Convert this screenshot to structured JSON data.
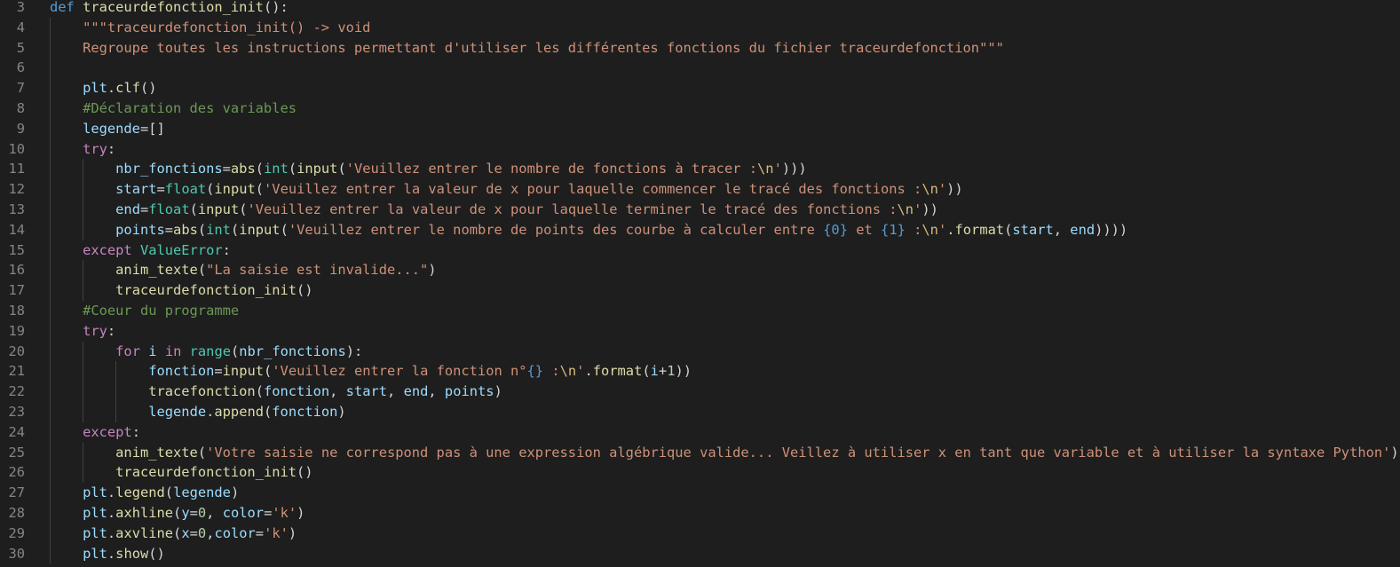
{
  "editor": {
    "lines": [
      {
        "number": "3",
        "indent": 0,
        "tokens": [
          [
            "kw",
            "def"
          ],
          [
            "txt",
            " "
          ],
          [
            "fn",
            "traceurdefonction_init"
          ],
          [
            "txt",
            "():"
          ]
        ]
      },
      {
        "number": "4",
        "indent": 1,
        "tokens": [
          [
            "str",
            "\"\"\"traceurdefonction_init() -> void"
          ]
        ]
      },
      {
        "number": "5",
        "indent": 1,
        "tokens": [
          [
            "str",
            "Regroupe toutes les instructions permettant d'utiliser les différentes fonctions du fichier traceurdefonction\"\"\""
          ]
        ]
      },
      {
        "number": "6",
        "indent": 1,
        "tokens": []
      },
      {
        "number": "7",
        "indent": 1,
        "tokens": [
          [
            "var",
            "plt"
          ],
          [
            "txt",
            "."
          ],
          [
            "fn",
            "clf"
          ],
          [
            "txt",
            "()"
          ]
        ]
      },
      {
        "number": "8",
        "indent": 1,
        "tokens": [
          [
            "cmt",
            "#Déclaration des variables"
          ]
        ]
      },
      {
        "number": "9",
        "indent": 1,
        "tokens": [
          [
            "var",
            "legende"
          ],
          [
            "op",
            "="
          ],
          [
            "txt",
            "[]"
          ]
        ]
      },
      {
        "number": "10",
        "indent": 1,
        "tokens": [
          [
            "ctrl",
            "try"
          ],
          [
            "txt",
            ":"
          ]
        ]
      },
      {
        "number": "11",
        "indent": 2,
        "tokens": [
          [
            "var",
            "nbr_fonctions"
          ],
          [
            "op",
            "="
          ],
          [
            "fn",
            "abs"
          ],
          [
            "txt",
            "("
          ],
          [
            "cls",
            "int"
          ],
          [
            "txt",
            "("
          ],
          [
            "fn",
            "input"
          ],
          [
            "txt",
            "("
          ],
          [
            "str",
            "'Veuillez entrer le nombre de fonctions à tracer :"
          ],
          [
            "esc",
            "\\n"
          ],
          [
            "str",
            "'"
          ],
          [
            "txt",
            ")))"
          ]
        ]
      },
      {
        "number": "12",
        "indent": 2,
        "tokens": [
          [
            "var",
            "start"
          ],
          [
            "op",
            "="
          ],
          [
            "cls",
            "float"
          ],
          [
            "txt",
            "("
          ],
          [
            "fn",
            "input"
          ],
          [
            "txt",
            "("
          ],
          [
            "str",
            "'Veuillez entrer la valeur de x pour laquelle commencer le tracé des fonctions :"
          ],
          [
            "esc",
            "\\n"
          ],
          [
            "str",
            "'"
          ],
          [
            "txt",
            "))"
          ]
        ]
      },
      {
        "number": "13",
        "indent": 2,
        "tokens": [
          [
            "var",
            "end"
          ],
          [
            "op",
            "="
          ],
          [
            "cls",
            "float"
          ],
          [
            "txt",
            "("
          ],
          [
            "fn",
            "input"
          ],
          [
            "txt",
            "("
          ],
          [
            "str",
            "'Veuillez entrer la valeur de x pour laquelle terminer le tracé des fonctions :"
          ],
          [
            "esc",
            "\\n"
          ],
          [
            "str",
            "'"
          ],
          [
            "txt",
            "))"
          ]
        ]
      },
      {
        "number": "14",
        "indent": 2,
        "tokens": [
          [
            "var",
            "points"
          ],
          [
            "op",
            "="
          ],
          [
            "fn",
            "abs"
          ],
          [
            "txt",
            "("
          ],
          [
            "cls",
            "int"
          ],
          [
            "txt",
            "("
          ],
          [
            "fn",
            "input"
          ],
          [
            "txt",
            "("
          ],
          [
            "str",
            "'Veuillez entrer le nombre de points des courbe à calculer entre "
          ],
          [
            "fmt",
            "{0}"
          ],
          [
            "str",
            " et "
          ],
          [
            "fmt",
            "{1}"
          ],
          [
            "str",
            " :"
          ],
          [
            "esc",
            "\\n"
          ],
          [
            "str",
            "'"
          ],
          [
            "txt",
            "."
          ],
          [
            "fn",
            "format"
          ],
          [
            "txt",
            "("
          ],
          [
            "var",
            "start"
          ],
          [
            "txt",
            ", "
          ],
          [
            "var",
            "end"
          ],
          [
            "txt",
            "))))"
          ]
        ]
      },
      {
        "number": "15",
        "indent": 1,
        "tokens": [
          [
            "ctrl",
            "except"
          ],
          [
            "txt",
            " "
          ],
          [
            "cls",
            "ValueError"
          ],
          [
            "txt",
            ":"
          ]
        ]
      },
      {
        "number": "16",
        "indent": 2,
        "tokens": [
          [
            "fn",
            "anim_texte"
          ],
          [
            "txt",
            "("
          ],
          [
            "str",
            "\"La saisie est invalide...\""
          ],
          [
            "txt",
            ")"
          ]
        ]
      },
      {
        "number": "17",
        "indent": 2,
        "tokens": [
          [
            "fn",
            "traceurdefonction_init"
          ],
          [
            "txt",
            "()"
          ]
        ]
      },
      {
        "number": "18",
        "indent": 1,
        "tokens": [
          [
            "cmt",
            "#Coeur du programme"
          ]
        ]
      },
      {
        "number": "19",
        "indent": 1,
        "tokens": [
          [
            "ctrl",
            "try"
          ],
          [
            "txt",
            ":"
          ]
        ]
      },
      {
        "number": "20",
        "indent": 2,
        "tokens": [
          [
            "ctrl",
            "for"
          ],
          [
            "txt",
            " "
          ],
          [
            "var",
            "i"
          ],
          [
            "txt",
            " "
          ],
          [
            "ctrl",
            "in"
          ],
          [
            "txt",
            " "
          ],
          [
            "cls",
            "range"
          ],
          [
            "txt",
            "("
          ],
          [
            "var",
            "nbr_fonctions"
          ],
          [
            "txt",
            "):"
          ]
        ]
      },
      {
        "number": "21",
        "indent": 3,
        "tokens": [
          [
            "var",
            "fonction"
          ],
          [
            "op",
            "="
          ],
          [
            "fn",
            "input"
          ],
          [
            "txt",
            "("
          ],
          [
            "str",
            "'Veuillez entrer la fonction n°"
          ],
          [
            "fmt",
            "{}"
          ],
          [
            "str",
            " :"
          ],
          [
            "esc",
            "\\n"
          ],
          [
            "str",
            "'"
          ],
          [
            "txt",
            "."
          ],
          [
            "fn",
            "format"
          ],
          [
            "txt",
            "("
          ],
          [
            "var",
            "i"
          ],
          [
            "op",
            "+"
          ],
          [
            "num",
            "1"
          ],
          [
            "txt",
            "))"
          ]
        ]
      },
      {
        "number": "22",
        "indent": 3,
        "tokens": [
          [
            "fn",
            "tracefonction"
          ],
          [
            "txt",
            "("
          ],
          [
            "var",
            "fonction"
          ],
          [
            "txt",
            ", "
          ],
          [
            "var",
            "start"
          ],
          [
            "txt",
            ", "
          ],
          [
            "var",
            "end"
          ],
          [
            "txt",
            ", "
          ],
          [
            "var",
            "points"
          ],
          [
            "txt",
            ")"
          ]
        ]
      },
      {
        "number": "23",
        "indent": 3,
        "tokens": [
          [
            "var",
            "legende"
          ],
          [
            "txt",
            "."
          ],
          [
            "fn",
            "append"
          ],
          [
            "txt",
            "("
          ],
          [
            "var",
            "fonction"
          ],
          [
            "txt",
            ")"
          ]
        ]
      },
      {
        "number": "24",
        "indent": 1,
        "tokens": [
          [
            "ctrl",
            "except"
          ],
          [
            "txt",
            ":"
          ]
        ]
      },
      {
        "number": "25",
        "indent": 2,
        "tokens": [
          [
            "fn",
            "anim_texte"
          ],
          [
            "txt",
            "("
          ],
          [
            "str",
            "'Votre saisie ne correspond pas à une expression algébrique valide... Veillez à utiliser x en tant que variable et à utiliser la syntaxe Python'"
          ],
          [
            "txt",
            ")"
          ]
        ]
      },
      {
        "number": "26",
        "indent": 2,
        "tokens": [
          [
            "fn",
            "traceurdefonction_init"
          ],
          [
            "txt",
            "()"
          ]
        ]
      },
      {
        "number": "27",
        "indent": 1,
        "tokens": [
          [
            "var",
            "plt"
          ],
          [
            "txt",
            "."
          ],
          [
            "fn",
            "legend"
          ],
          [
            "txt",
            "("
          ],
          [
            "var",
            "legende"
          ],
          [
            "txt",
            ")"
          ]
        ]
      },
      {
        "number": "28",
        "indent": 1,
        "tokens": [
          [
            "var",
            "plt"
          ],
          [
            "txt",
            "."
          ],
          [
            "fn",
            "axhline"
          ],
          [
            "txt",
            "("
          ],
          [
            "var",
            "y"
          ],
          [
            "op",
            "="
          ],
          [
            "num",
            "0"
          ],
          [
            "txt",
            ", "
          ],
          [
            "var",
            "color"
          ],
          [
            "op",
            "="
          ],
          [
            "str",
            "'k'"
          ],
          [
            "txt",
            ")"
          ]
        ]
      },
      {
        "number": "29",
        "indent": 1,
        "tokens": [
          [
            "var",
            "plt"
          ],
          [
            "txt",
            "."
          ],
          [
            "fn",
            "axvline"
          ],
          [
            "txt",
            "("
          ],
          [
            "var",
            "x"
          ],
          [
            "op",
            "="
          ],
          [
            "num",
            "0"
          ],
          [
            "txt",
            ","
          ],
          [
            "var",
            "color"
          ],
          [
            "op",
            "="
          ],
          [
            "str",
            "'k'"
          ],
          [
            "txt",
            ")"
          ]
        ]
      },
      {
        "number": "30",
        "indent": 1,
        "tokens": [
          [
            "var",
            "plt"
          ],
          [
            "txt",
            "."
          ],
          [
            "fn",
            "show"
          ],
          [
            "txt",
            "()"
          ]
        ]
      }
    ]
  }
}
